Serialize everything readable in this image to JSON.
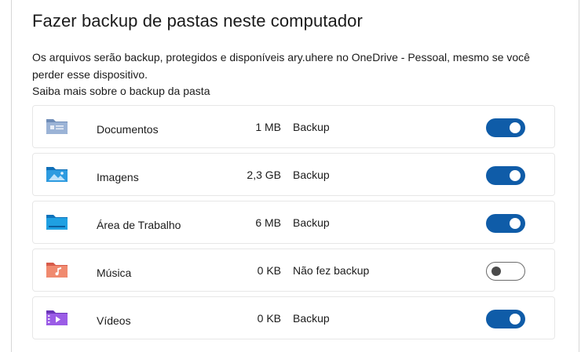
{
  "header": {
    "title": "Fazer backup de pastas neste computador",
    "description": "Os arquivos serão backup, protegidos e disponíveis ary.uhere no OneDrive - Pessoal, mesmo se você perder esse dispositivo.",
    "learn_more": "Saiba mais sobre o backup da pasta"
  },
  "folders": [
    {
      "name": "Documentos",
      "size": "1 MB",
      "status": "Backup",
      "enabled": true,
      "icon": "documents-folder-icon"
    },
    {
      "name": "Imagens",
      "size": "2,3 GB",
      "status": "Backup",
      "enabled": true,
      "icon": "pictures-folder-icon"
    },
    {
      "name": "Área de Trabalho",
      "size": "6 MB",
      "status": "Backup",
      "enabled": true,
      "icon": "desktop-folder-icon"
    },
    {
      "name": "Música",
      "size": "0 KB",
      "status": "Não fez backup",
      "enabled": false,
      "icon": "music-folder-icon"
    },
    {
      "name": "Vídeos",
      "size": "0 KB",
      "status": "Backup",
      "enabled": true,
      "icon": "videos-folder-icon"
    }
  ],
  "colors": {
    "toggle_on": "#0f5ca8",
    "documents": "#7f9bc2",
    "pictures": "#1a8ed8",
    "desktop": "#1a9ad9",
    "music": "#e8735a",
    "videos": "#8a4fd6"
  }
}
